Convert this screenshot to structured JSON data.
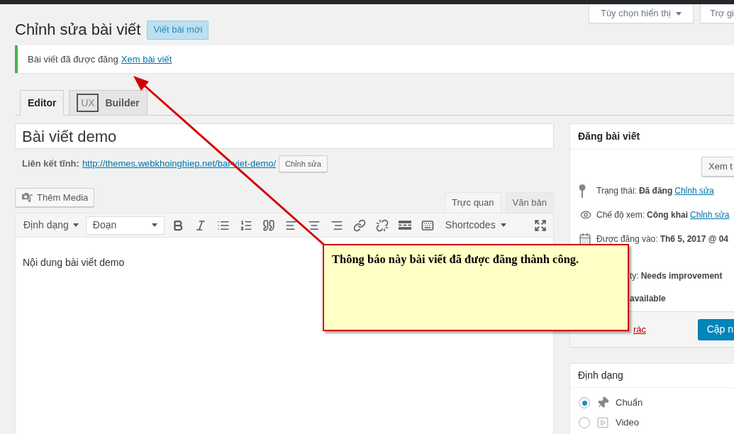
{
  "screen_options": [
    {
      "label": "Tùy chọn hiển thị",
      "dropdown": true
    },
    {
      "label": "Trợ gi",
      "dropdown": false
    }
  ],
  "page": {
    "title": "Chỉnh sửa bài viết",
    "add_new": "Viết bài mới"
  },
  "notice": {
    "text": "Bài viết đã được đăng",
    "link": "Xem bài viết"
  },
  "builder_tabs": [
    {
      "label": "Editor",
      "selected": true
    },
    {
      "badge": "UX",
      "label": "Builder",
      "selected": false
    }
  ],
  "post_title": {
    "value": "Bài viết demo"
  },
  "permalink": {
    "label": "Liên kết tĩnh:",
    "url": "http://themes.webkhoinghiep.net/bai-viet-demo/",
    "button": "Chỉnh sửa"
  },
  "add_media": "Thêm Media",
  "editor_tabs": [
    {
      "label": "Trực quan",
      "selected": true
    },
    {
      "label": "Văn bản",
      "selected": false
    }
  ],
  "toolbar": {
    "format_menu": "Định dạng",
    "block_format": "Đoạn",
    "shortcodes": "Shortcodes"
  },
  "content": "Nội dung bài viết demo",
  "publish_box": {
    "title": "Đăng bài viết",
    "preview": "Xem t",
    "rows": [
      {
        "kind": "status",
        "label": "Trạng thái:",
        "value": "Đã đăng",
        "link": "Chỉnh sửa"
      },
      {
        "kind": "visibility",
        "label": "Chế độ xem:",
        "value": "Công khai",
        "link": "Chỉnh sửa"
      },
      {
        "kind": "date",
        "label": "Được đăng vào:",
        "value": "Th6 5, 2017 @ 04"
      },
      {
        "kind": "readability",
        "label": "ty:",
        "value": "Needs improvement"
      },
      {
        "kind": "seo",
        "value": "available"
      }
    ],
    "trash": "rác",
    "update": "Cập n"
  },
  "format_box": {
    "title": "Định dạng",
    "options": [
      {
        "kind": "standard",
        "label": "Chuẩn",
        "selected": true
      },
      {
        "kind": "video",
        "label": "Video",
        "selected": false
      }
    ]
  },
  "callout": {
    "text": "Thông báo này bài viết đã được đăng thành công."
  }
}
